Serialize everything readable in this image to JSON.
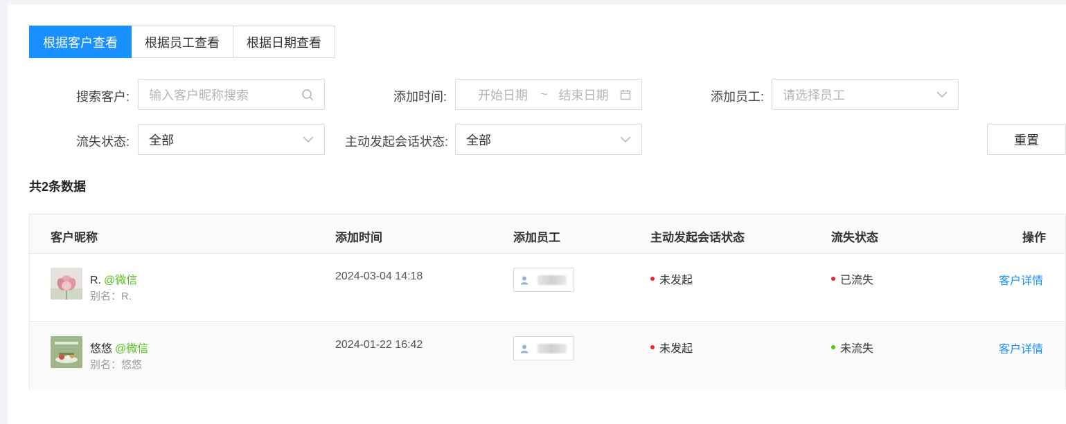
{
  "tabs": [
    {
      "label": "根据客户查看",
      "active": true
    },
    {
      "label": "根据员工查看",
      "active": false
    },
    {
      "label": "根据日期查看",
      "active": false
    }
  ],
  "filters": {
    "customer_label": "搜索客户:",
    "customer_placeholder": "输入客户昵称搜索",
    "time_label": "添加时间:",
    "start_placeholder": "开始日期",
    "range_sep": "~",
    "end_placeholder": "结束日期",
    "employee_label": "添加员工:",
    "employee_placeholder": "请选择员工",
    "churn_label": "流失状态:",
    "churn_value": "全部",
    "chat_label": "主动发起会话状态:",
    "chat_value": "全部",
    "reset_label": "重置"
  },
  "total_text": "共2条数据",
  "table": {
    "headers": [
      "客户昵称",
      "添加时间",
      "添加员工",
      "主动发起会话状态",
      "流失状态",
      "操作"
    ],
    "rows": [
      {
        "nickname": "R.",
        "source": "@微信",
        "alias": "别名：R.",
        "time": "2024-03-04 14:18",
        "chat_status": "未发起",
        "chat_color": "#f5222d",
        "churn_status": "已流失",
        "churn_color": "#f5222d",
        "action": "客户详情"
      },
      {
        "nickname": "悠悠",
        "source": "@微信",
        "alias": "别名：悠悠",
        "time": "2024-01-22 16:42",
        "chat_status": "未发起",
        "chat_color": "#f5222d",
        "churn_status": "未流失",
        "churn_color": "#52c41a",
        "action": "客户详情"
      }
    ]
  },
  "colors": {
    "primary": "#1890ff",
    "wechat": "#52c41a"
  }
}
